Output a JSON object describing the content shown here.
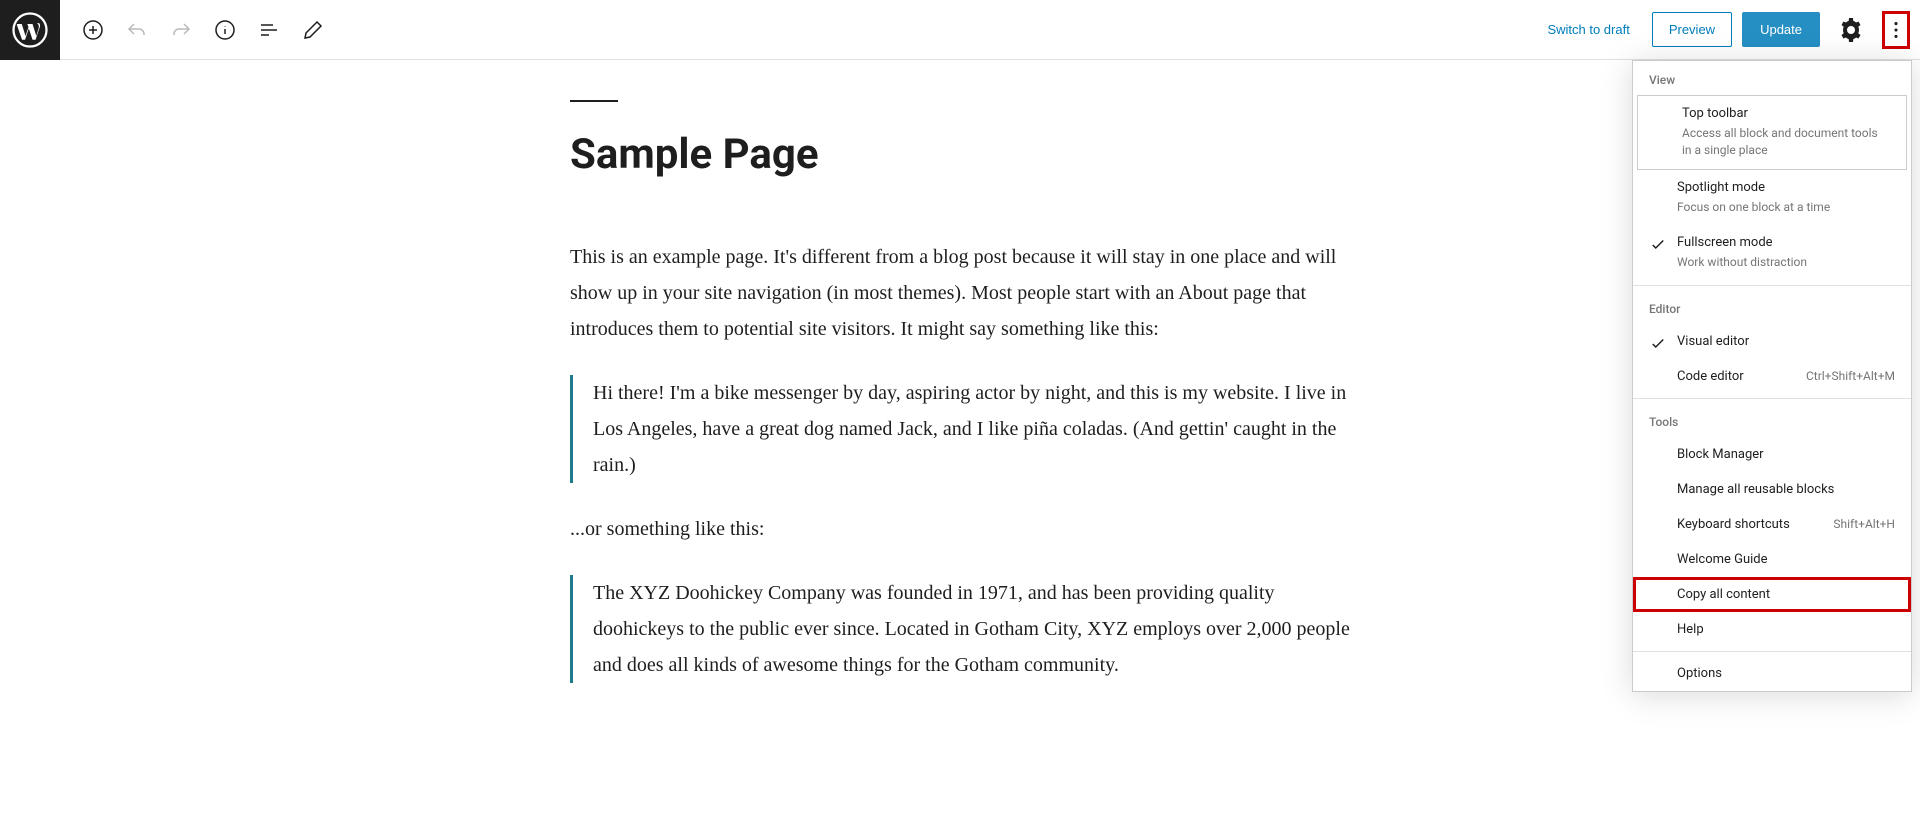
{
  "toolbar": {
    "switch_draft": "Switch to draft",
    "preview": "Preview",
    "update": "Update"
  },
  "content": {
    "title": "Sample Page",
    "para1": "This is an example page. It's different from a blog post because it will stay in one place and will show up in your site navigation (in most themes). Most people start with an About page that introduces them to potential site visitors. It might say something like this:",
    "quote1": "Hi there! I'm a bike messenger by day, aspiring actor by night, and this is my website. I live in Los Angeles, have a great dog named Jack, and I like piña coladas. (And gettin' caught in the rain.)",
    "para2": "...or something like this:",
    "quote2": "The XYZ Doohickey Company was founded in 1971, and has been providing quality doohickeys to the public ever since. Located in Gotham City, XYZ employs over 2,000 people and does all kinds of awesome things for the Gotham community."
  },
  "menu": {
    "view_label": "View",
    "top_toolbar": {
      "title": "Top toolbar",
      "desc": "Access all block and document tools in a single place"
    },
    "spotlight": {
      "title": "Spotlight mode",
      "desc": "Focus on one block at a time"
    },
    "fullscreen": {
      "title": "Fullscreen mode",
      "desc": "Work without distraction"
    },
    "editor_label": "Editor",
    "visual_editor": "Visual editor",
    "code_editor": "Code editor",
    "code_editor_shortcut": "Ctrl+Shift+Alt+M",
    "tools_label": "Tools",
    "block_manager": "Block Manager",
    "reusable_blocks": "Manage all reusable blocks",
    "keyboard_shortcuts": "Keyboard shortcuts",
    "keyboard_shortcut_key": "Shift+Alt+H",
    "welcome_guide": "Welcome Guide",
    "copy_all": "Copy all content",
    "help": "Help",
    "options": "Options"
  }
}
